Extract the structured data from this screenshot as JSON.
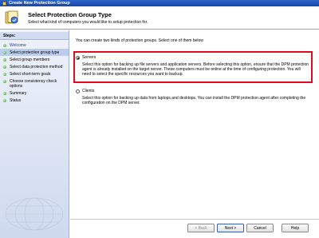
{
  "window": {
    "title": "Create New Protection Group"
  },
  "header": {
    "title": "Select Protection Group Type",
    "subtitle": "Select what kind of computers you would like to setup protection for."
  },
  "sidebar": {
    "heading": "Steps:",
    "items": [
      {
        "label": "Welcome",
        "active": false
      },
      {
        "label": "Select protection group type",
        "active": true
      },
      {
        "label": "Select group members",
        "active": false
      },
      {
        "label": "Select data protection method",
        "active": false
      },
      {
        "label": "Select short-term goals",
        "active": false
      },
      {
        "label": "Choose consistency check options",
        "active": false
      },
      {
        "label": "Summary",
        "active": false
      },
      {
        "label": "Status",
        "active": false
      }
    ]
  },
  "main": {
    "intro": "You can create two kinds of protection groups. Select one of them below",
    "options": [
      {
        "label": "Servers",
        "selected": true,
        "description": "Select this option for backing up file servers and application servers. Before selecting this option, ensure that the DPM protection agent is already installed on the target server. These computers must be online at the time of configuring protection. You will need to select the specific resources you want to backup."
      },
      {
        "label": "Clients",
        "selected": false,
        "description": "Select this option for backing up data from laptops and desktops. You can install the DPM protection agent after completing the configuration on the DPM server."
      }
    ],
    "highlight_color": "#e20a1e"
  },
  "buttons": {
    "back": "< Back",
    "next": "Next >",
    "cancel": "Cancel",
    "help": "Help"
  },
  "icons": {
    "title_icon": "app-icon",
    "header_icon": "wizard-icon"
  }
}
